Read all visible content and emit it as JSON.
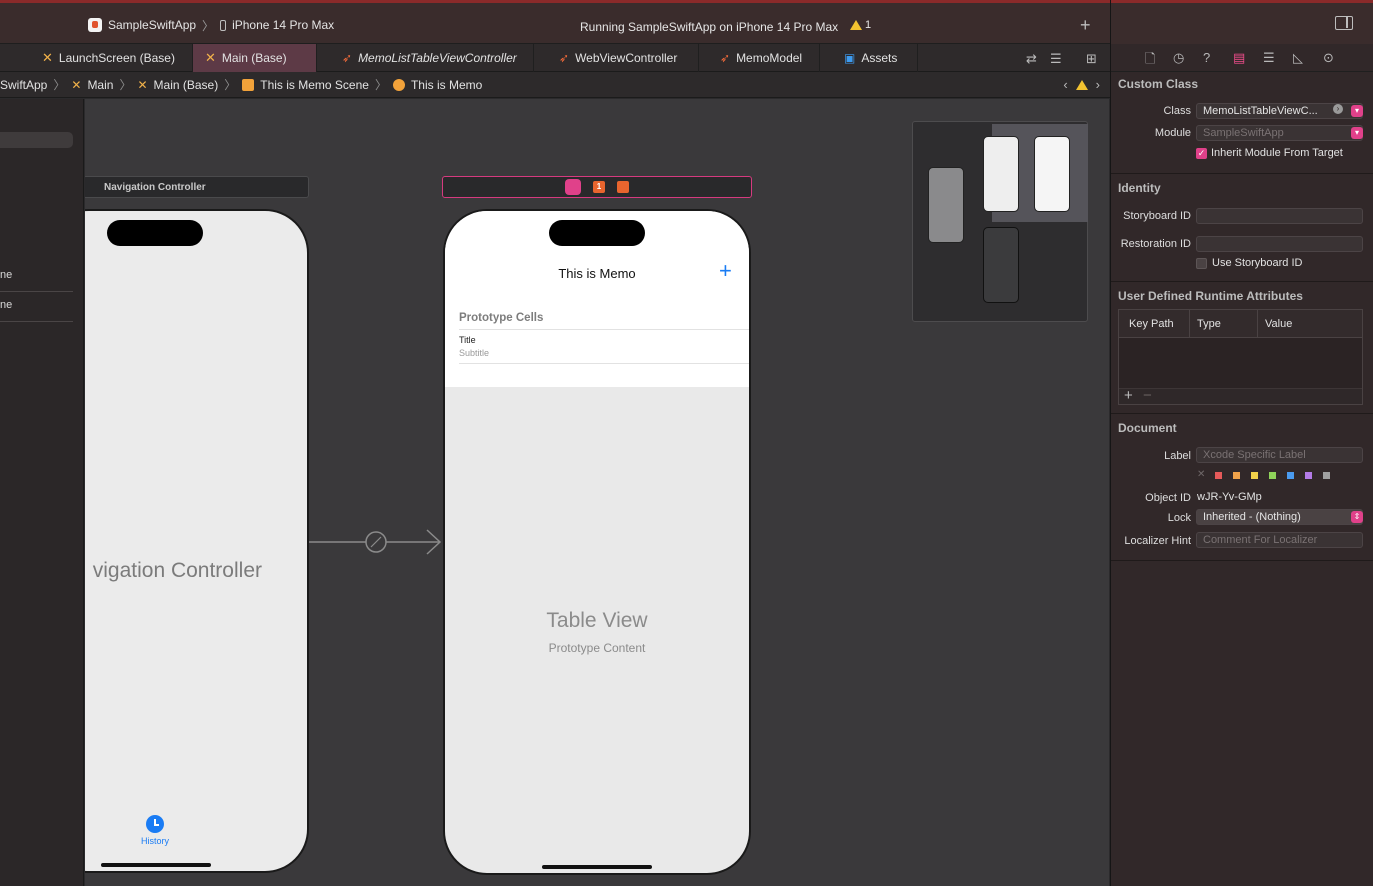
{
  "toolbar": {
    "scheme_app": "SampleSwiftApp",
    "scheme_device": "iPhone 14 Pro Max",
    "status_text": "Running SampleSwiftApp on iPhone 14 Pro Max",
    "warning_count": "1",
    "add_label": "+"
  },
  "tabs": [
    {
      "label": "LaunchScreen (Base)"
    },
    {
      "label": "Main (Base)"
    },
    {
      "label": "MemoListTableViewController"
    },
    {
      "label": "WebViewController"
    },
    {
      "label": "MemoModel"
    },
    {
      "label": "Assets"
    }
  ],
  "jumpbar": {
    "items": [
      "SwiftApp",
      "Main",
      "Main (Base)",
      "This is Memo Scene",
      "This is Memo"
    ]
  },
  "navigator": {
    "rows": [
      "ne",
      "ne"
    ]
  },
  "canvas": {
    "nav_scene_title": "Navigation Controller",
    "nav_placeholder": "vigation Controller",
    "tab_item_label": "History",
    "memo_nav_title": "This is Memo",
    "add_button": "+",
    "prototype_header": "Prototype Cells",
    "cell_title": "Title",
    "cell_subtitle": "Subtitle",
    "table_view_title": "Table View",
    "table_view_subtitle": "Prototype Content",
    "scene_icon_badge": "1"
  },
  "inspector": {
    "custom_class": {
      "title": "Custom Class",
      "class_label": "Class",
      "class_value": "MemoListTableViewC...",
      "module_label": "Module",
      "module_value": "SampleSwiftApp",
      "inherit_label": "Inherit Module From Target"
    },
    "identity": {
      "title": "Identity",
      "storyboard_id_label": "Storyboard ID",
      "restoration_id_label": "Restoration ID",
      "use_storyboard_id_label": "Use Storyboard ID"
    },
    "runtime_attributes": {
      "title": "User Defined Runtime Attributes",
      "columns": [
        "Key Path",
        "Type",
        "Value"
      ]
    },
    "document": {
      "title": "Document",
      "label_label": "Label",
      "label_placeholder": "Xcode Specific Label",
      "object_id_label": "Object ID",
      "object_id_value": "wJR-Yv-GMp",
      "lock_label": "Lock",
      "lock_value": "Inherited - (Nothing)",
      "localizer_hint_label": "Localizer Hint",
      "localizer_hint_placeholder": "Comment For Localizer"
    },
    "label_colors": [
      "#e65a5a",
      "#f0a24a",
      "#f2d24a",
      "#8fd35a",
      "#4a9bef",
      "#b37be6",
      "#a0a0a0"
    ]
  },
  "colors": {
    "accent_pink": "#e0418a",
    "ios_blue": "#1a7cf4"
  }
}
